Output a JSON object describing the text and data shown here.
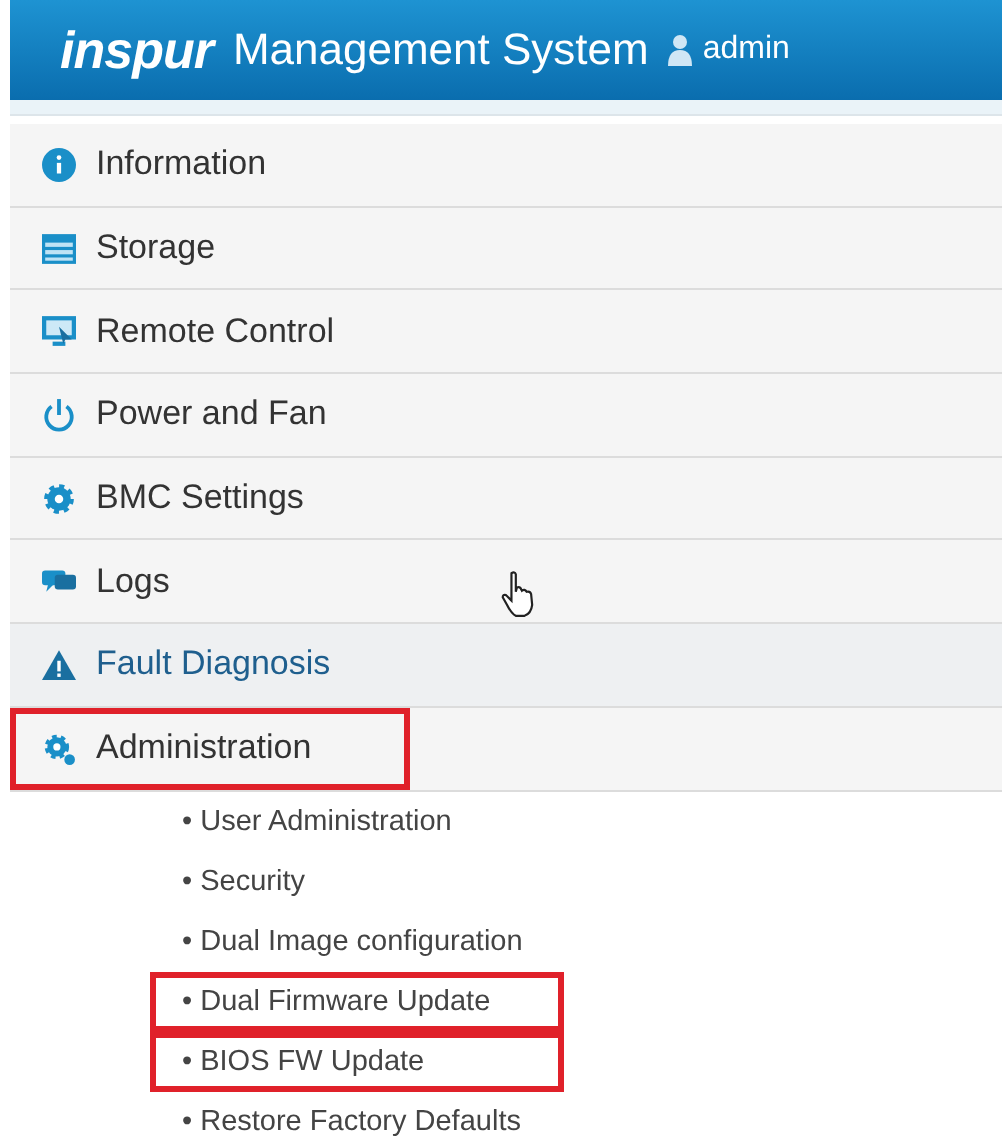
{
  "header": {
    "logo": "inspur",
    "title": "Management System",
    "user": "admin"
  },
  "menu": [
    {
      "label": "Information",
      "kind": "info",
      "active": false,
      "highlighted": false
    },
    {
      "label": "Storage",
      "kind": "storage",
      "active": false,
      "highlighted": false
    },
    {
      "label": "Remote Control",
      "kind": "monitor",
      "active": false,
      "highlighted": false
    },
    {
      "label": "Power and Fan",
      "kind": "power",
      "active": false,
      "highlighted": false
    },
    {
      "label": "BMC Settings",
      "kind": "gear",
      "active": false,
      "highlighted": false
    },
    {
      "label": "Logs",
      "kind": "chat",
      "active": false,
      "highlighted": false
    },
    {
      "label": "Fault Diagnosis",
      "kind": "warning",
      "active": true,
      "highlighted": false
    },
    {
      "label": "Administration",
      "kind": "gears",
      "active": false,
      "highlighted": true,
      "children": [
        {
          "label": "• User Administration",
          "highlighted": false
        },
        {
          "label": "• Security",
          "highlighted": false
        },
        {
          "label": "• Dual Image configuration",
          "highlighted": false
        },
        {
          "label": "• Dual Firmware Update",
          "highlighted": true
        },
        {
          "label": "• BIOS FW Update",
          "highlighted": true
        },
        {
          "label": "• Restore Factory Defaults",
          "highlighted": false
        }
      ]
    }
  ]
}
